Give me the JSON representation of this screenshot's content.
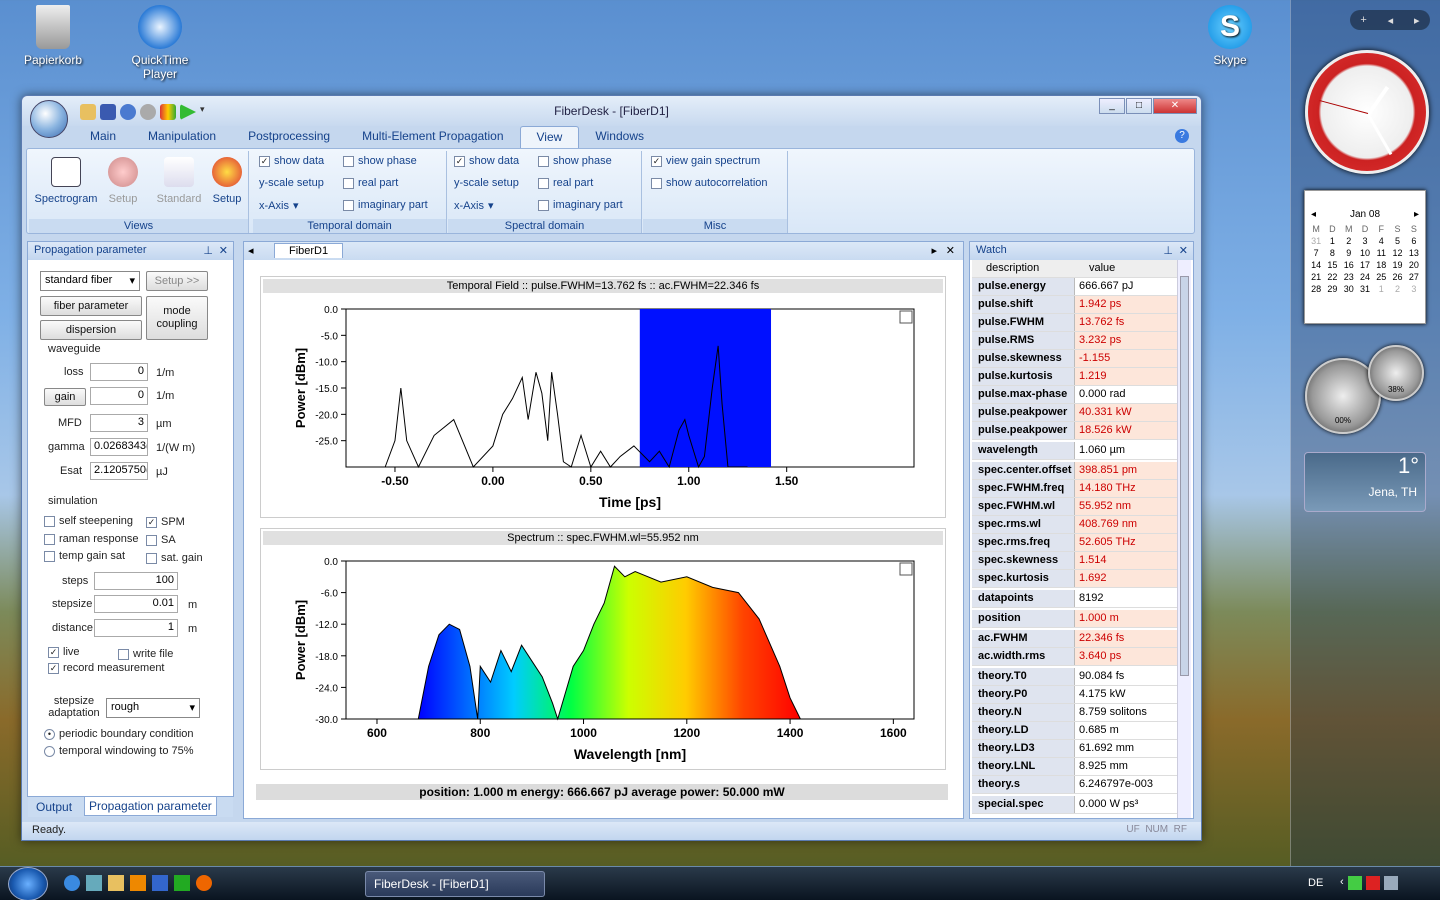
{
  "desktop": {
    "icons": [
      {
        "label": "Papierkorb"
      },
      {
        "label": "QuickTime Player"
      },
      {
        "label": "Skype"
      }
    ]
  },
  "sidebar": {
    "calendar": {
      "month": "Jan 08",
      "weekdays": [
        "M",
        "D",
        "M",
        "D",
        "F",
        "S",
        "S"
      ],
      "days": [
        "31",
        "1",
        "2",
        "3",
        "4",
        "5",
        "6",
        "7",
        "8",
        "9",
        "10",
        "11",
        "12",
        "13",
        "14",
        "15",
        "16",
        "17",
        "18",
        "19",
        "20",
        "21",
        "22",
        "23",
        "24",
        "25",
        "26",
        "27",
        "28",
        "29",
        "30",
        "31",
        "1",
        "2",
        "3"
      ]
    },
    "gauge1": "00%",
    "gauge2": "38%",
    "weather": {
      "temp": "1°",
      "city": "Jena, TH"
    }
  },
  "window": {
    "title": "FiberDesk - [FiberD1]",
    "tabs": [
      "Main",
      "Manipulation",
      "Postprocessing",
      "Multi-Element Propagation",
      "View",
      "Windows"
    ],
    "active_tab": "View",
    "ribbon": {
      "views": {
        "label": "Views",
        "spectrogram": "Spectrogram",
        "setup1": "Setup",
        "standard": "Standard",
        "setup2": "Setup"
      },
      "temporal": {
        "label": "Temporal domain",
        "show_data": "show data",
        "show_phase": "show phase",
        "yscale": "y-scale setup",
        "real_part": "real part",
        "xaxis": "x-Axis",
        "imag_part": "imaginary part"
      },
      "spectral": {
        "label": "Spectral domain",
        "show_data": "show data",
        "show_phase": "show phase",
        "yscale": "y-scale setup",
        "real_part": "real part",
        "xaxis": "x-Axis",
        "imag_part": "imaginary part"
      },
      "misc": {
        "label": "Misc",
        "view_gain": "view gain spectrum",
        "show_autocorr": "show autocorrelation"
      }
    },
    "left_panel": {
      "title": "Propagation parameter",
      "fiber_type": "standard fiber",
      "setup_btn": "Setup >>",
      "fiber_param_btn": "fiber parameter",
      "dispersion_btn": "dispersion",
      "mode_coupling_btn": "mode coupling",
      "waveguide_label": "waveguide",
      "loss": {
        "label": "loss",
        "value": "0",
        "unit": "1/m"
      },
      "gain": {
        "label": "gain",
        "value": "0",
        "unit": "1/m"
      },
      "mfd": {
        "label": "MFD",
        "value": "3",
        "unit": "µm"
      },
      "gamma": {
        "label": "gamma",
        "value": "0.0268343(",
        "unit": "1/(W m)"
      },
      "esat": {
        "label": "Esat",
        "value": "2.1205750(",
        "unit": "µJ"
      },
      "simulation_label": "simulation",
      "self_steepening": "self steepening",
      "spm": "SPM",
      "raman": "raman response",
      "sa": "SA",
      "temp_gain_sat": "temp gain sat",
      "sat_gain": "sat. gain",
      "steps": {
        "label": "steps",
        "value": "100"
      },
      "stepsize": {
        "label": "stepsize",
        "value": "0.01",
        "unit": "m"
      },
      "distance": {
        "label": "distance",
        "value": "1",
        "unit": "m"
      },
      "live": "live",
      "write_file": "write file",
      "record": "record measurement",
      "stepsize_adapt": "stepsize adaptation",
      "adapt_value": "rough",
      "periodic": "periodic boundary condition",
      "windowing": "temporal windowing to 75%",
      "bottom_tabs": [
        "Output",
        "Propagation parameter"
      ]
    },
    "doc": {
      "tab": "FiberD1",
      "temporal_title": "Temporal Field  ::  pulse.FWHM=13.762 fs  ::  ac.FWHM=22.346 fs",
      "spectrum_title": "Spectrum  ::  spec.FWHM.wl=55.952 nm",
      "footer": "position: 1.000  m   energy: 666.667 pJ   average power: 50.000 mW"
    },
    "watch": {
      "title": "Watch",
      "col_desc": "description",
      "col_value": "value",
      "rows": [
        {
          "d": "pulse.energy",
          "v": "666.667 pJ",
          "c": "white"
        },
        {
          "d": "pulse.shift",
          "v": "1.942 ps",
          "c": "red"
        },
        {
          "d": "pulse.FWHM",
          "v": "13.762 fs",
          "c": "red"
        },
        {
          "d": "pulse.RMS",
          "v": "3.232 ps",
          "c": "red"
        },
        {
          "d": "pulse.skewness",
          "v": "-1.155",
          "c": "red"
        },
        {
          "d": "pulse.kurtosis",
          "v": "1.219",
          "c": "red"
        },
        {
          "d": "pulse.max-phase",
          "v": "0.000 rad",
          "c": "white"
        },
        {
          "d": "pulse.peakpower",
          "v": "40.331 kW",
          "c": "red"
        },
        {
          "d": "pulse.peakpower",
          "v": "18.526 kW",
          "c": "red"
        },
        {
          "d": "wavelength",
          "v": "1.060 µm",
          "c": "white",
          "sep": true
        },
        {
          "d": "spec.center.offset",
          "v": "398.851 pm",
          "c": "red",
          "sep": true
        },
        {
          "d": "spec.FWHM.freq",
          "v": "14.180 THz",
          "c": "red"
        },
        {
          "d": "spec.FWHM.wl",
          "v": "55.952 nm",
          "c": "red"
        },
        {
          "d": "spec.rms.wl",
          "v": "408.769 nm",
          "c": "red"
        },
        {
          "d": "spec.rms.freq",
          "v": "52.605 THz",
          "c": "red"
        },
        {
          "d": "spec.skewness",
          "v": "1.514",
          "c": "red"
        },
        {
          "d": "spec.kurtosis",
          "v": "1.692",
          "c": "red"
        },
        {
          "d": "datapoints",
          "v": "8192",
          "c": "white",
          "sep": true
        },
        {
          "d": "position",
          "v": "1.000  m",
          "c": "red",
          "sep": true
        },
        {
          "d": "ac.FWHM",
          "v": "22.346 fs",
          "c": "red",
          "sep": true
        },
        {
          "d": "ac.width.rms",
          "v": "3.640 ps",
          "c": "red"
        },
        {
          "d": "theory.T0",
          "v": "90.084 fs",
          "c": "white",
          "sep": true
        },
        {
          "d": "theory.P0",
          "v": "4.175 kW",
          "c": "white"
        },
        {
          "d": "theory.N",
          "v": "8.759 solitons",
          "c": "white"
        },
        {
          "d": "theory.LD",
          "v": "0.685  m",
          "c": "white"
        },
        {
          "d": "theory.LD3",
          "v": "61.692 mm",
          "c": "white"
        },
        {
          "d": "theory.LNL",
          "v": "8.925 mm",
          "c": "white"
        },
        {
          "d": "theory.s",
          "v": "6.246797e-003",
          "c": "white"
        },
        {
          "d": "special.spec",
          "v": "0.000 W ps³",
          "c": "white",
          "sep": true
        }
      ]
    },
    "status": {
      "text": "Ready.",
      "indicators": [
        "UF",
        "NUM",
        "RF"
      ]
    }
  },
  "taskbar": {
    "task": "FiberDesk - [FiberD1]",
    "lang": "DE"
  },
  "chart_data": [
    {
      "type": "line",
      "title": "Temporal Field  ::  pulse.FWHM=13.762 fs  ::  ac.FWHM=22.346 fs",
      "xlabel": "Time [ps]",
      "ylabel": "Power [dBm]",
      "xlim": [
        -0.75,
        2.15
      ],
      "ylim": [
        -30,
        0
      ],
      "xticks": [
        "-0.50",
        "0.00",
        "0.50",
        "1.00",
        "1.50"
      ],
      "yticks": [
        "0.0",
        "-5.0",
        "-10.0",
        "-15.0",
        "-20.0",
        "-25.0"
      ],
      "selection": [
        0.75,
        1.42
      ],
      "x": [
        -0.55,
        -0.5,
        -0.47,
        -0.44,
        -0.38,
        -0.3,
        -0.2,
        -0.1,
        0.0,
        0.05,
        0.1,
        0.15,
        0.18,
        0.22,
        0.25,
        0.28,
        0.3,
        0.33,
        0.36,
        0.4,
        0.45,
        0.5,
        0.55,
        0.6,
        0.65,
        0.72,
        0.8,
        0.85,
        0.9,
        0.95,
        0.98,
        1.0,
        1.05,
        1.08,
        1.12,
        1.15,
        1.17,
        1.2,
        1.25,
        1.3
      ],
      "y": [
        -30,
        -25,
        -15,
        -25,
        -30,
        -24,
        -21,
        -30,
        -26,
        -20,
        -17,
        -13,
        -21,
        -12,
        -16,
        -25,
        -12,
        -20,
        -29,
        -30,
        -24,
        -30,
        -27,
        -30,
        -28,
        -26,
        -29,
        -27,
        -30,
        -23,
        -21,
        -24,
        -30,
        -28,
        -15,
        -7,
        -18,
        -30,
        -30,
        -30
      ]
    },
    {
      "type": "area",
      "title": "Spectrum  ::  spec.FWHM.wl=55.952 nm",
      "xlabel": "Wavelength [nm]",
      "ylabel": "Power [dBm]",
      "xlim": [
        540,
        1640
      ],
      "ylim": [
        -30,
        0
      ],
      "xticks": [
        "600",
        "800",
        "1000",
        "1200",
        "1400",
        "1600"
      ],
      "yticks": [
        "0.0",
        "-6.0",
        "-12.0",
        "-18.0",
        "-24.0",
        "-30.0"
      ],
      "x": [
        680,
        700,
        720,
        740,
        760,
        780,
        795,
        800,
        820,
        840,
        860,
        880,
        900,
        920,
        940,
        950,
        980,
        1000,
        1020,
        1040,
        1060,
        1080,
        1100,
        1150,
        1200,
        1250,
        1300,
        1340,
        1380,
        1400,
        1420
      ],
      "y": [
        -30,
        -20,
        -14,
        -12,
        -13,
        -20,
        -30,
        -20,
        -23,
        -17,
        -21,
        -16,
        -19,
        -22,
        -27,
        -30,
        -20,
        -17,
        -12,
        -8,
        -1,
        -3,
        -2,
        -4,
        -3,
        -5,
        -6,
        -11,
        -20,
        -26,
        -30
      ]
    }
  ]
}
